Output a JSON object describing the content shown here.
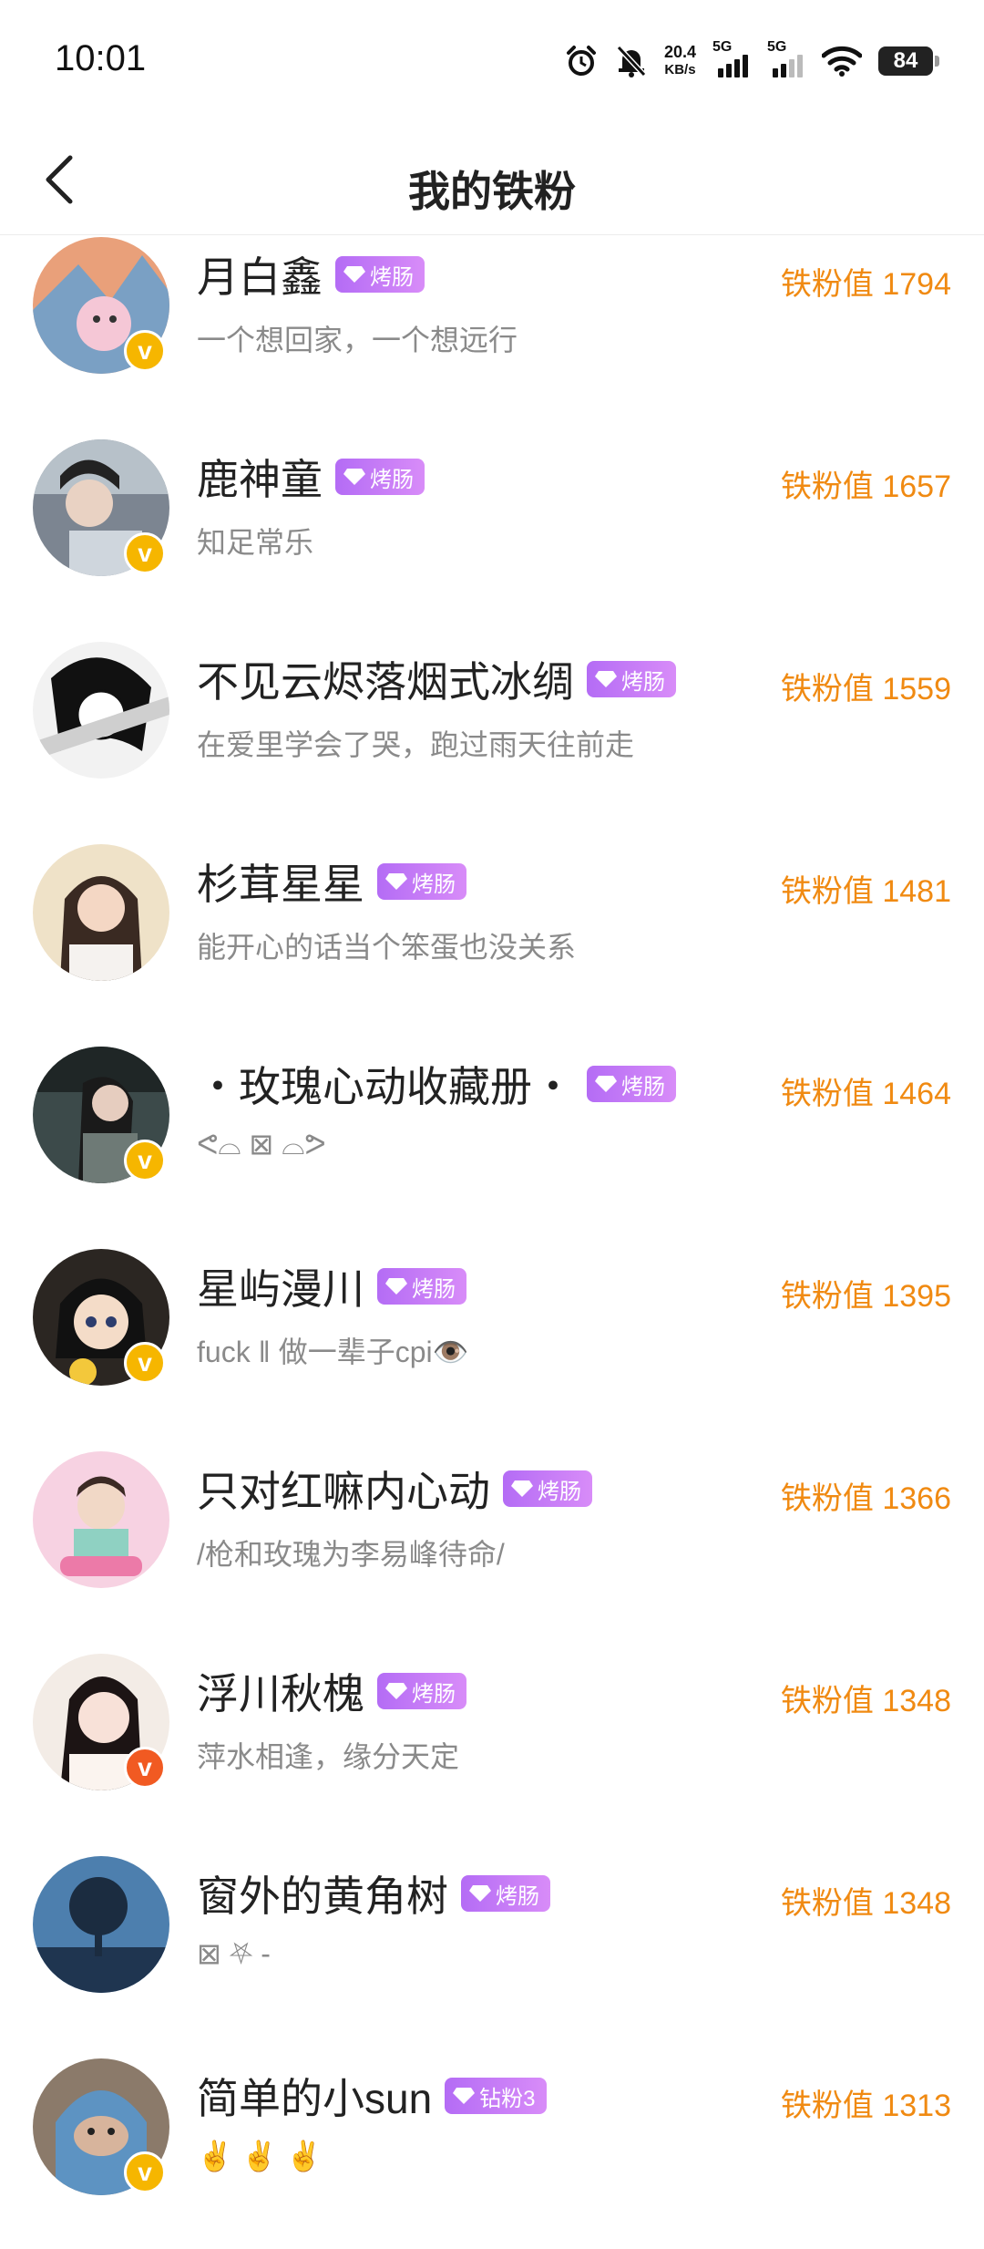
{
  "status_bar": {
    "time": "10:01",
    "net_speed_value": "20.4",
    "net_speed_unit": "KB/s",
    "sim1": "5G",
    "sim2": "5G",
    "battery": "84",
    "icons": [
      "alarm-icon",
      "mute-bell-icon",
      "wifi-icon"
    ]
  },
  "header": {
    "title": "我的铁粉",
    "back_icon": "chevron-left-icon"
  },
  "colors": {
    "accent_orange": "#f08a12",
    "tag_purple": "#b46cf5",
    "badge_yellow": "#f6b600",
    "badge_orange": "#f15a22"
  },
  "fans": [
    {
      "name": "月白鑫",
      "tag": "烤肠",
      "bio": "一个想回家，一个想远行",
      "value": "铁粉值 1794",
      "verified": "yellow"
    },
    {
      "name": "鹿神童",
      "tag": "烤肠",
      "bio": "知足常乐",
      "value": "铁粉值 1657",
      "verified": "yellow"
    },
    {
      "name": "不见云烬落烟式冰绸",
      "tag": "烤肠",
      "bio": "在爱里学会了哭，跑过雨天往前走",
      "value": "铁粉值 1559",
      "verified": "none"
    },
    {
      "name": "杉茸星星",
      "tag": "烤肠",
      "bio": "能开心的话当个笨蛋也没关系",
      "value": "铁粉值 1481",
      "verified": "none"
    },
    {
      "name": "・玫瑰心动收藏册・",
      "tag": "烤肠",
      "bio": "ᕙ⌓ ⊠ ⌓ᕗ",
      "value": "铁粉值 1464",
      "verified": "yellow"
    },
    {
      "name": "星屿漫川",
      "tag": "烤肠",
      "bio": "fuck ‖ 做一辈子cpi👁️",
      "value": "铁粉值 1395",
      "verified": "yellow"
    },
    {
      "name": "只对红嘛内心动",
      "tag": "烤肠",
      "bio": "/枪和玫瑰为李易峰待命/",
      "value": "铁粉值 1366",
      "verified": "none"
    },
    {
      "name": "浮川秋槐",
      "tag": "烤肠",
      "bio": "萍水相逢，缘分天定",
      "value": "铁粉值 1348",
      "verified": "orange"
    },
    {
      "name": "窗外的黄角树",
      "tag": "烤肠",
      "bio": "⊠ ⛧ -",
      "value": "铁粉值 1348",
      "verified": "none"
    },
    {
      "name": "简单的小sun",
      "tag": "钻粉3",
      "bio": "✌️ ✌️ ✌️",
      "value": "铁粉值 1313",
      "verified": "yellow"
    }
  ]
}
